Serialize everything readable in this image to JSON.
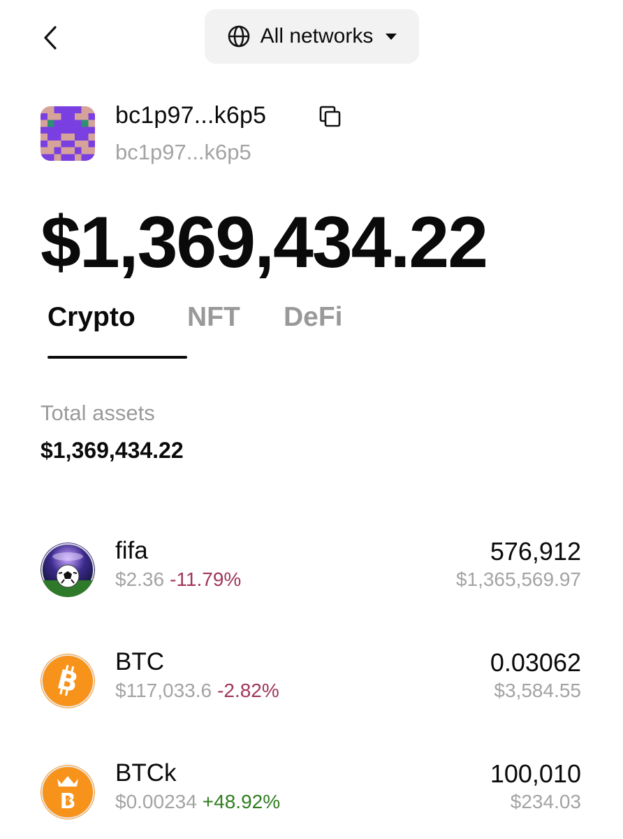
{
  "header": {
    "network_label": "All networks"
  },
  "wallet": {
    "address_title": "bc1p97...k6p5",
    "address_subtitle": "bc1p97...k6p5",
    "balance": "$1,369,434.22"
  },
  "tabs": [
    {
      "label": "Crypto",
      "active": true
    },
    {
      "label": "NFT",
      "active": false
    },
    {
      "label": "DeFi",
      "active": false
    }
  ],
  "summary": {
    "total_label": "Total assets",
    "total_value": "$1,369,434.22"
  },
  "assets": [
    {
      "name": "fifa",
      "price": "$2.36",
      "change": "-11.79%",
      "change_direction": "down",
      "amount": "576,912",
      "value": "$1,365,569.97",
      "icon": "soccer-ball-icon"
    },
    {
      "name": "BTC",
      "price": "$117,033.6",
      "change": "-2.82%",
      "change_direction": "down",
      "amount": "0.03062",
      "value": "$3,584.55",
      "icon": "bitcoin-icon"
    },
    {
      "name": "BTCk",
      "price": "$0.00234",
      "change": "+48.92%",
      "change_direction": "up",
      "amount": "100,010",
      "value": "$234.03",
      "icon": "btck-icon"
    }
  ],
  "colors": {
    "negative": "#a0355c",
    "positive": "#2f7d1f",
    "bitcoin_orange": "#f7931a",
    "muted_text": "#a3a3a3"
  }
}
